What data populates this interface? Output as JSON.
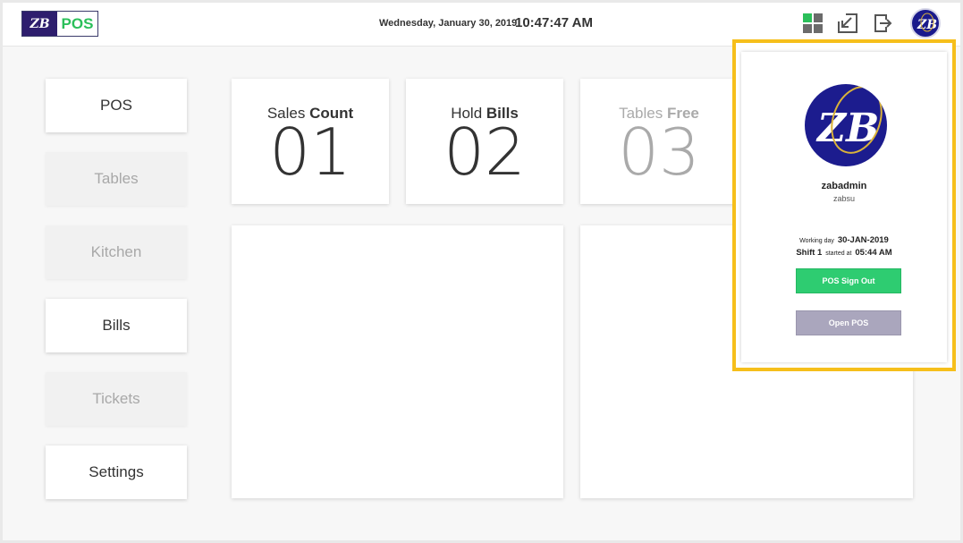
{
  "header": {
    "logo_mark": "ZB",
    "logo_text": "POS",
    "date": "Wednesday, January 30, 2019",
    "time": "10:47:47 AM",
    "icons": [
      "grid-icon",
      "resize-icon",
      "sign-out-icon",
      "avatar-icon"
    ]
  },
  "menu": [
    {
      "label": "POS",
      "enabled": true
    },
    {
      "label": "Tables",
      "enabled": false
    },
    {
      "label": "Kitchen",
      "enabled": false
    },
    {
      "label": "Bills",
      "enabled": true
    },
    {
      "label": "Tickets",
      "enabled": false
    },
    {
      "label": "Settings",
      "enabled": true
    }
  ],
  "stats": [
    {
      "label_light": "Sales ",
      "label_bold": "Count",
      "value": "01"
    },
    {
      "label_light": "Hold ",
      "label_bold": "Bills",
      "value": "02"
    },
    {
      "label_light": "Tables ",
      "label_bold": "Free",
      "value": "03"
    }
  ],
  "profile": {
    "username": "zabadmin",
    "userid": "zabsu",
    "working_day_label": "Working day",
    "working_day": "30-JAN-2019",
    "shift": "Shift 1",
    "started_label": "started at",
    "started_time": "05:44 AM",
    "sign_out_label": "POS Sign Out",
    "open_pos_label": "Open POS"
  },
  "colors": {
    "accent_green": "#2ecc71",
    "brand_purple": "#2e1e6e",
    "highlight": "#f6bf1b",
    "disabled_button": "#aaa6bd"
  }
}
